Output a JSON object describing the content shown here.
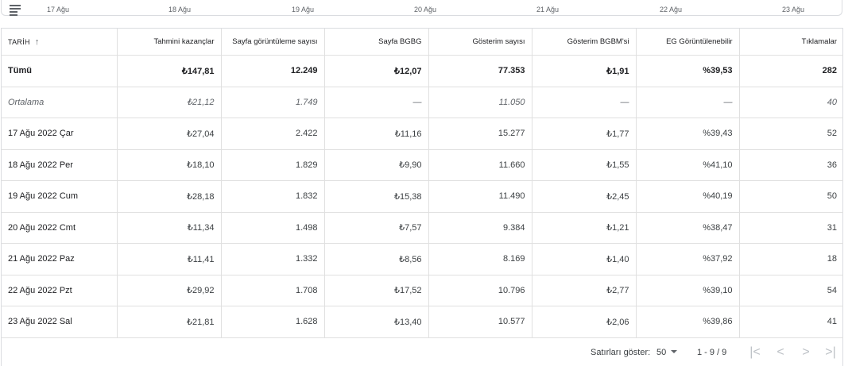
{
  "chart_axis": {
    "ticks": [
      "17 Ağu",
      "18 Ağu",
      "19 Ağu",
      "20 Ağu",
      "21 Ağu",
      "22 Ağu",
      "23 Ağu"
    ]
  },
  "table": {
    "headers": [
      "TARİH",
      "Tahmini kazançlar",
      "Sayfa görüntüleme sayısı",
      "Sayfa BGBG",
      "Gösterim sayısı",
      "Gösterim BGBM'si",
      "EG Görüntülenebilir",
      "Tıklamalar"
    ],
    "total": [
      "Tümü",
      "₺147,81",
      "12.249",
      "₺12,07",
      "77.353",
      "₺1,91",
      "%39,53",
      "282"
    ],
    "average": [
      "Ortalama",
      "₺21,12",
      "1.749",
      "—",
      "11.050",
      "—",
      "—",
      "40"
    ],
    "rows": [
      [
        "17 Ağu 2022 Çar",
        "₺27,04",
        "2.422",
        "₺11,16",
        "15.277",
        "₺1,77",
        "%39,43",
        "52"
      ],
      [
        "18 Ağu 2022 Per",
        "₺18,10",
        "1.829",
        "₺9,90",
        "11.660",
        "₺1,55",
        "%41,10",
        "36"
      ],
      [
        "19 Ağu 2022 Cum",
        "₺28,18",
        "1.832",
        "₺15,38",
        "11.490",
        "₺2,45",
        "%40,19",
        "50"
      ],
      [
        "20 Ağu 2022 Cmt",
        "₺11,34",
        "1.498",
        "₺7,57",
        "9.384",
        "₺1,21",
        "%38,47",
        "31"
      ],
      [
        "21 Ağu 2022 Paz",
        "₺11,41",
        "1.332",
        "₺8,56",
        "8.169",
        "₺1,40",
        "%37,92",
        "18"
      ],
      [
        "22 Ağu 2022 Pzt",
        "₺29,92",
        "1.708",
        "₺17,52",
        "10.796",
        "₺2,77",
        "%39,10",
        "54"
      ],
      [
        "23 Ağu 2022 Sal",
        "₺21,81",
        "1.628",
        "₺13,40",
        "10.577",
        "₺2,06",
        "%39,86",
        "41"
      ]
    ]
  },
  "footer": {
    "rows_label": "Satırları göster:",
    "rows_value": "50",
    "range": "1 - 9 / 9",
    "first_icon": "first-page-icon",
    "prev_icon": "chevron-left-icon",
    "next_icon": "chevron-right-icon",
    "last_icon": "last-page-icon"
  }
}
